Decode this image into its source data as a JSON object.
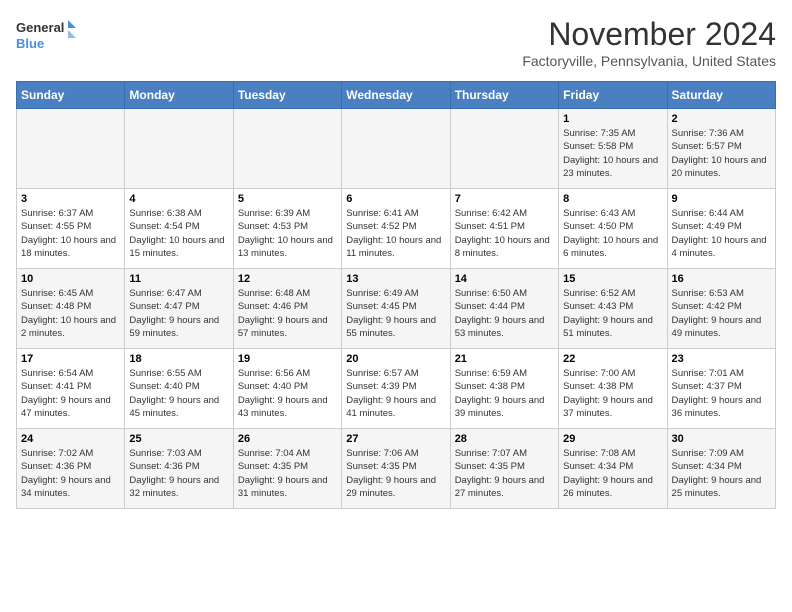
{
  "logo": {
    "line1": "General",
    "line2": "Blue"
  },
  "title": "November 2024",
  "subtitle": "Factoryville, Pennsylvania, United States",
  "days_of_week": [
    "Sunday",
    "Monday",
    "Tuesday",
    "Wednesday",
    "Thursday",
    "Friday",
    "Saturday"
  ],
  "weeks": [
    [
      {
        "day": "",
        "info": ""
      },
      {
        "day": "",
        "info": ""
      },
      {
        "day": "",
        "info": ""
      },
      {
        "day": "",
        "info": ""
      },
      {
        "day": "",
        "info": ""
      },
      {
        "day": "1",
        "info": "Sunrise: 7:35 AM\nSunset: 5:58 PM\nDaylight: 10 hours and 23 minutes."
      },
      {
        "day": "2",
        "info": "Sunrise: 7:36 AM\nSunset: 5:57 PM\nDaylight: 10 hours and 20 minutes."
      }
    ],
    [
      {
        "day": "3",
        "info": "Sunrise: 6:37 AM\nSunset: 4:55 PM\nDaylight: 10 hours and 18 minutes."
      },
      {
        "day": "4",
        "info": "Sunrise: 6:38 AM\nSunset: 4:54 PM\nDaylight: 10 hours and 15 minutes."
      },
      {
        "day": "5",
        "info": "Sunrise: 6:39 AM\nSunset: 4:53 PM\nDaylight: 10 hours and 13 minutes."
      },
      {
        "day": "6",
        "info": "Sunrise: 6:41 AM\nSunset: 4:52 PM\nDaylight: 10 hours and 11 minutes."
      },
      {
        "day": "7",
        "info": "Sunrise: 6:42 AM\nSunset: 4:51 PM\nDaylight: 10 hours and 8 minutes."
      },
      {
        "day": "8",
        "info": "Sunrise: 6:43 AM\nSunset: 4:50 PM\nDaylight: 10 hours and 6 minutes."
      },
      {
        "day": "9",
        "info": "Sunrise: 6:44 AM\nSunset: 4:49 PM\nDaylight: 10 hours and 4 minutes."
      }
    ],
    [
      {
        "day": "10",
        "info": "Sunrise: 6:45 AM\nSunset: 4:48 PM\nDaylight: 10 hours and 2 minutes."
      },
      {
        "day": "11",
        "info": "Sunrise: 6:47 AM\nSunset: 4:47 PM\nDaylight: 9 hours and 59 minutes."
      },
      {
        "day": "12",
        "info": "Sunrise: 6:48 AM\nSunset: 4:46 PM\nDaylight: 9 hours and 57 minutes."
      },
      {
        "day": "13",
        "info": "Sunrise: 6:49 AM\nSunset: 4:45 PM\nDaylight: 9 hours and 55 minutes."
      },
      {
        "day": "14",
        "info": "Sunrise: 6:50 AM\nSunset: 4:44 PM\nDaylight: 9 hours and 53 minutes."
      },
      {
        "day": "15",
        "info": "Sunrise: 6:52 AM\nSunset: 4:43 PM\nDaylight: 9 hours and 51 minutes."
      },
      {
        "day": "16",
        "info": "Sunrise: 6:53 AM\nSunset: 4:42 PM\nDaylight: 9 hours and 49 minutes."
      }
    ],
    [
      {
        "day": "17",
        "info": "Sunrise: 6:54 AM\nSunset: 4:41 PM\nDaylight: 9 hours and 47 minutes."
      },
      {
        "day": "18",
        "info": "Sunrise: 6:55 AM\nSunset: 4:40 PM\nDaylight: 9 hours and 45 minutes."
      },
      {
        "day": "19",
        "info": "Sunrise: 6:56 AM\nSunset: 4:40 PM\nDaylight: 9 hours and 43 minutes."
      },
      {
        "day": "20",
        "info": "Sunrise: 6:57 AM\nSunset: 4:39 PM\nDaylight: 9 hours and 41 minutes."
      },
      {
        "day": "21",
        "info": "Sunrise: 6:59 AM\nSunset: 4:38 PM\nDaylight: 9 hours and 39 minutes."
      },
      {
        "day": "22",
        "info": "Sunrise: 7:00 AM\nSunset: 4:38 PM\nDaylight: 9 hours and 37 minutes."
      },
      {
        "day": "23",
        "info": "Sunrise: 7:01 AM\nSunset: 4:37 PM\nDaylight: 9 hours and 36 minutes."
      }
    ],
    [
      {
        "day": "24",
        "info": "Sunrise: 7:02 AM\nSunset: 4:36 PM\nDaylight: 9 hours and 34 minutes."
      },
      {
        "day": "25",
        "info": "Sunrise: 7:03 AM\nSunset: 4:36 PM\nDaylight: 9 hours and 32 minutes."
      },
      {
        "day": "26",
        "info": "Sunrise: 7:04 AM\nSunset: 4:35 PM\nDaylight: 9 hours and 31 minutes."
      },
      {
        "day": "27",
        "info": "Sunrise: 7:06 AM\nSunset: 4:35 PM\nDaylight: 9 hours and 29 minutes."
      },
      {
        "day": "28",
        "info": "Sunrise: 7:07 AM\nSunset: 4:35 PM\nDaylight: 9 hours and 27 minutes."
      },
      {
        "day": "29",
        "info": "Sunrise: 7:08 AM\nSunset: 4:34 PM\nDaylight: 9 hours and 26 minutes."
      },
      {
        "day": "30",
        "info": "Sunrise: 7:09 AM\nSunset: 4:34 PM\nDaylight: 9 hours and 25 minutes."
      }
    ]
  ]
}
